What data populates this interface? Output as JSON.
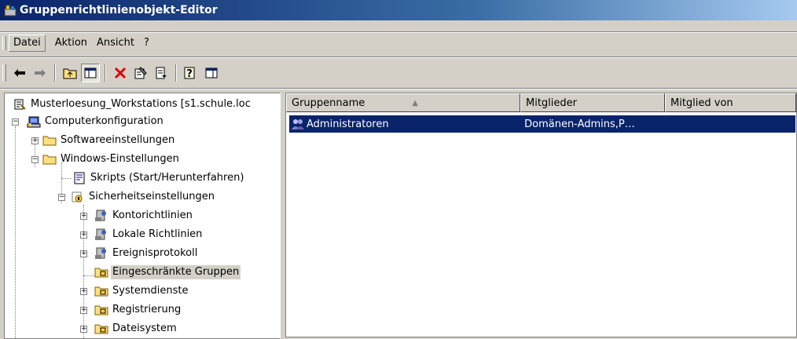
{
  "window": {
    "title": "Gruppenrichtlinienobjekt-Editor",
    "app_icon": "gpedit-icon"
  },
  "menu": {
    "items": [
      {
        "label": "Datei"
      },
      {
        "label": "Aktion"
      },
      {
        "label": "Ansicht"
      },
      {
        "label": "?"
      }
    ]
  },
  "toolbar": {
    "buttons": [
      "back-arrow-icon",
      "forward-arrow-icon",
      "up-folder-icon",
      "show-hide-tree-icon",
      "delete-icon",
      "properties-icon",
      "export-list-icon",
      "help-icon",
      "console-icon"
    ]
  },
  "tree": {
    "root": "Musterloesung_Workstations [s1.schule.loc",
    "items": [
      {
        "label": "Computerkonfiguration"
      },
      {
        "label": "Softwareeinstellungen"
      },
      {
        "label": "Windows-Einstellungen"
      },
      {
        "label": "Skripts (Start/Herunterfahren)"
      },
      {
        "label": "Sicherheitseinstellungen"
      },
      {
        "label": "Kontorichtlinien"
      },
      {
        "label": "Lokale Richtlinien"
      },
      {
        "label": "Ereignisprotokoll"
      },
      {
        "label": "Eingeschränkte Gruppen"
      },
      {
        "label": "Systemdienste"
      },
      {
        "label": "Registrierung"
      },
      {
        "label": "Dateisystem"
      }
    ]
  },
  "list": {
    "columns": [
      {
        "label": "Gruppenname"
      },
      {
        "label": "Mitglieder"
      },
      {
        "label": "Mitglied von"
      }
    ],
    "rows": [
      {
        "name": "Administratoren",
        "members": "Domänen-Admins,P…",
        "member_of": ""
      }
    ]
  },
  "colors": {
    "selection": "#0a246a",
    "titlebar_start": "#0a246a",
    "titlebar_end": "#a6caf0",
    "face": "#d4d0c8"
  }
}
